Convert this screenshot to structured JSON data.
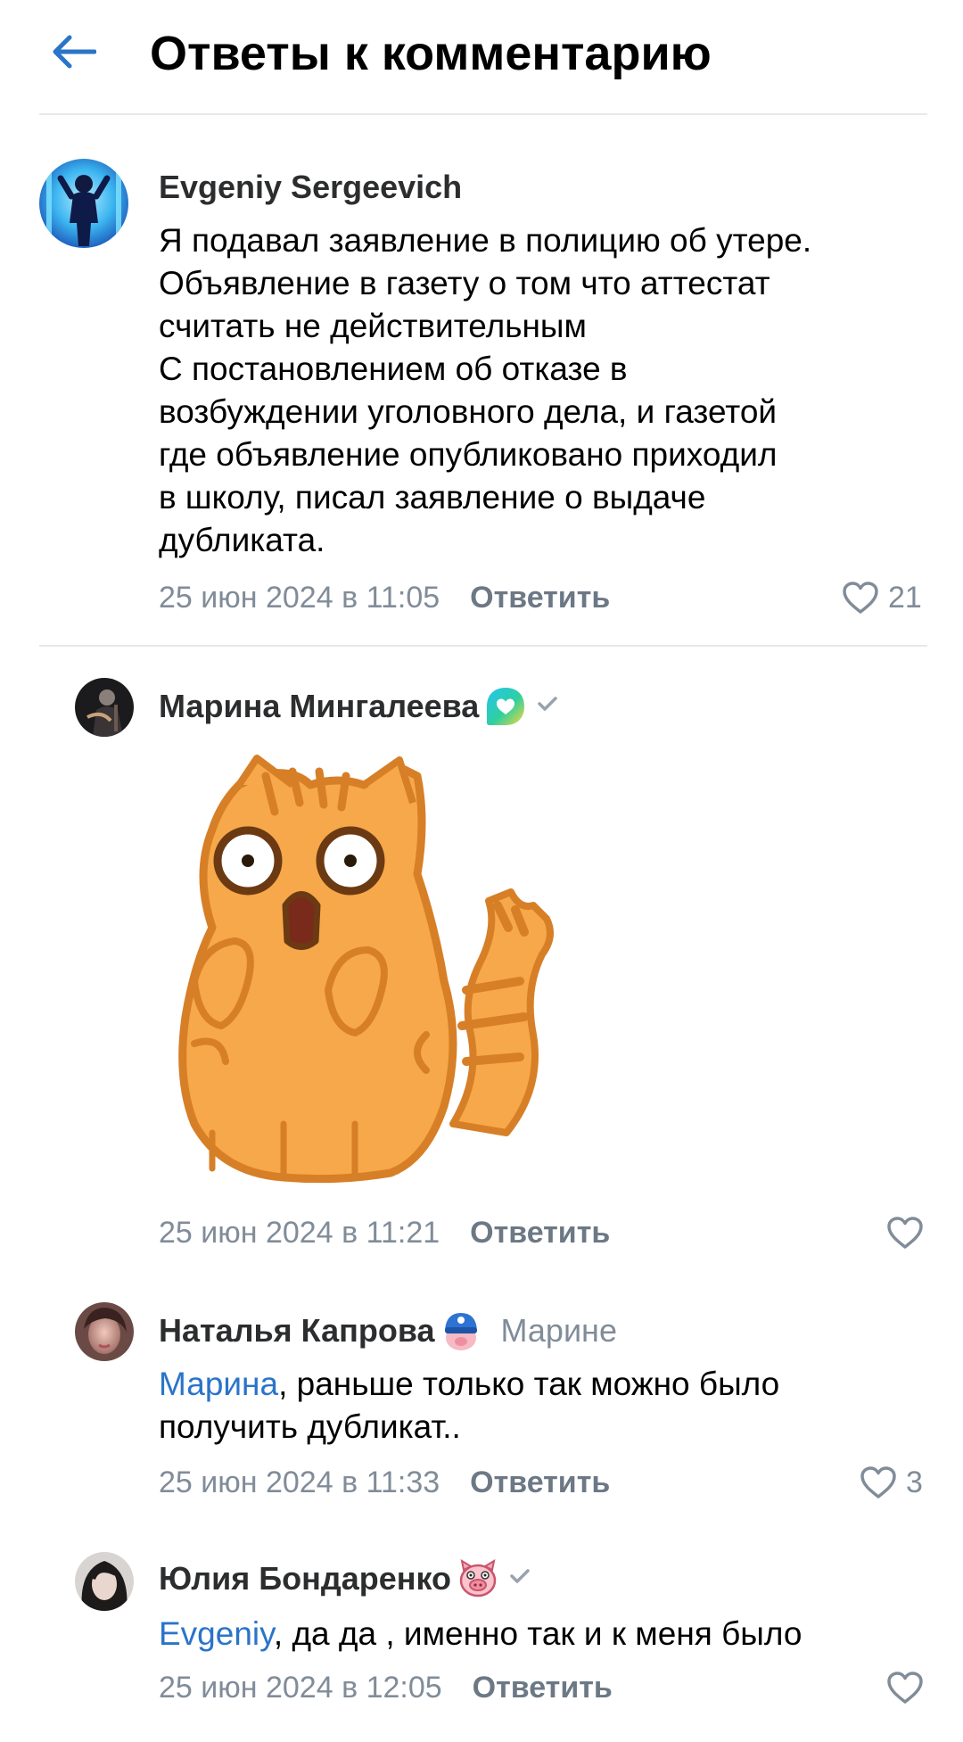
{
  "header": {
    "title": "Ответы к комментарию"
  },
  "comments": [
    {
      "author": "Evgeniy Sergeevich",
      "lines": [
        "Я подавал заявление в полицию об утере.",
        "Объявление в газету о том что аттестат",
        "считать не действительным",
        "С постановлением об отказе в",
        "возбуждении уголовного дела, и газетой",
        "где объявление опубликовано приходил",
        "в школу, писал заявление о выдаче",
        "дубликата."
      ],
      "date": "25 июн 2024 в 11:05",
      "reply_label": "Ответить",
      "likes": "21"
    },
    {
      "author": "Марина Мингалеева",
      "date": "25 июн 2024 в 11:21",
      "reply_label": "Ответить",
      "sticker": "shocked-cat-sticker"
    },
    {
      "author": "Наталья Капрова",
      "addressee": "Марине",
      "mention": "Марина",
      "text_rest": ", раньше только так можно было",
      "text_line2": "получить дубликат..",
      "date": "25 июн 2024 в 11:33",
      "reply_label": "Ответить",
      "likes": "3"
    },
    {
      "author": "Юлия Бондаренко",
      "mention": "Evgeniy",
      "text_rest": ", да да , именно так и к меня было",
      "date": "25 июн 2024 в 12:05",
      "reply_label": "Ответить"
    }
  ],
  "colors": {
    "accent": "#2a74c9",
    "secondary_text": "#818c99",
    "divider": "#e7e8ec"
  }
}
